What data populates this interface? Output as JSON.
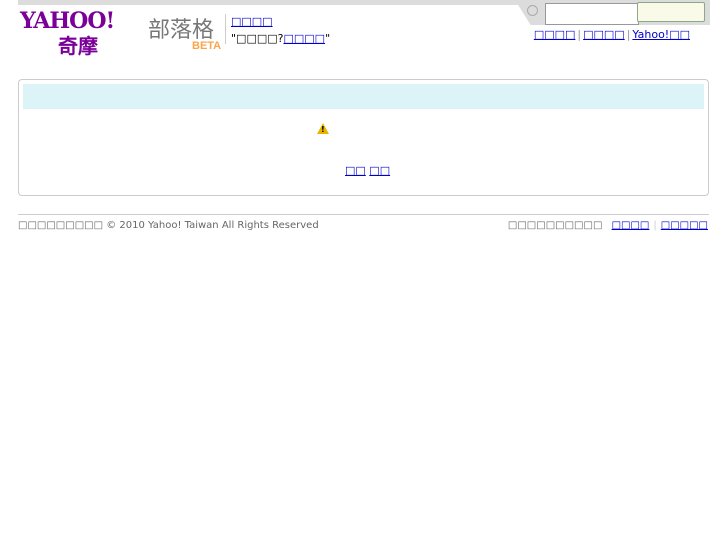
{
  "logo": {
    "yahoo": "YAHOO!",
    "qimo": "奇摩",
    "blog": "部落格",
    "beta": "BETA"
  },
  "header": {
    "link1": "□□□□",
    "quote_open": "\"□□□□?",
    "quote_link": "□□□□",
    "quote_close": "\""
  },
  "search": {
    "value": "",
    "button": ""
  },
  "top_links": [
    "□□□□",
    "□□□□",
    "Yahoo!□□"
  ],
  "content": {
    "warning_icon": "warning-icon",
    "links": [
      "□□",
      "□□"
    ]
  },
  "footer": {
    "copyright": "□□□□□□□□□ © 2010 Yahoo! Taiwan All Rights Reserved",
    "text": "□□□□□□□□□□",
    "links": [
      "□□□□",
      "□□□□□"
    ]
  }
}
